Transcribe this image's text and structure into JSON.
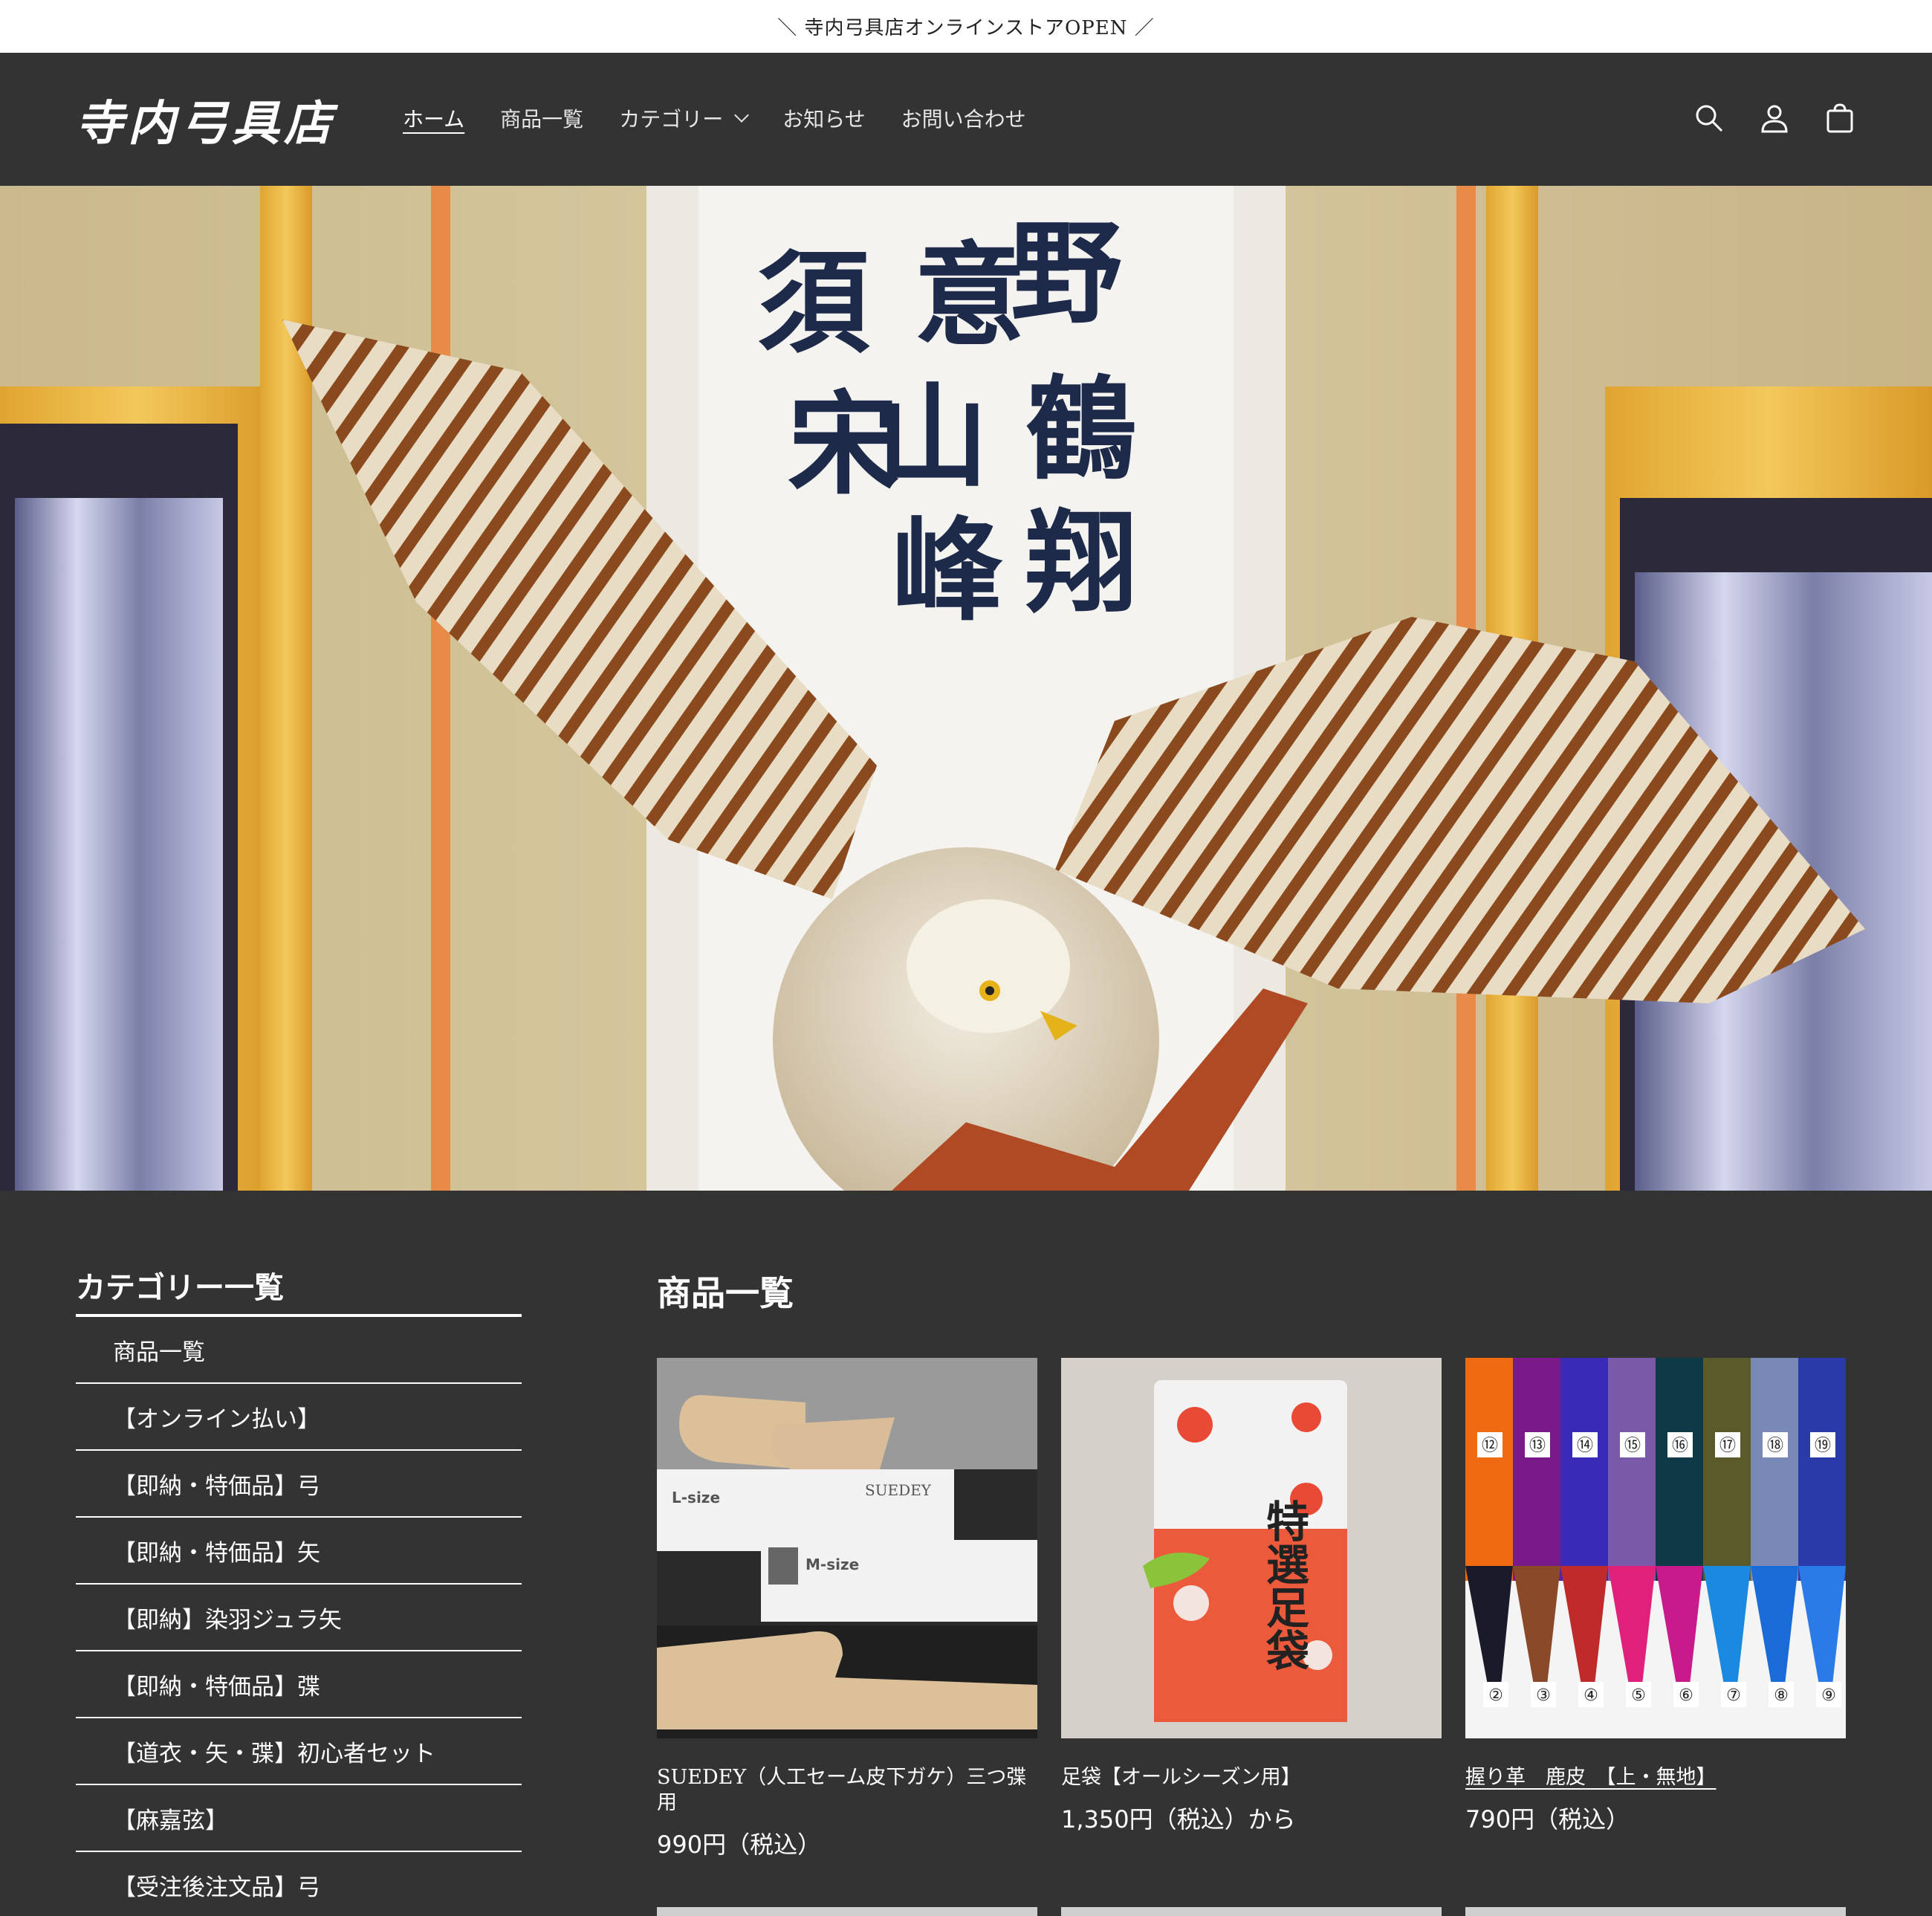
{
  "announcement": "＼ 寺内弓具店オンラインストアOPEN ／",
  "header": {
    "logo": "寺内弓具店",
    "nav": [
      {
        "label": "ホーム",
        "active": true
      },
      {
        "label": "商品一覧"
      },
      {
        "label": "カテゴリー",
        "dropdown": true
      },
      {
        "label": "お知らせ"
      },
      {
        "label": "お問い合わせ"
      }
    ],
    "icons": [
      "search-icon",
      "account-icon",
      "cart-icon"
    ]
  },
  "hero": {
    "calligraphy": [
      "野",
      "意",
      "須",
      "鶴",
      "山",
      "宋",
      "翔",
      "峰"
    ]
  },
  "sidebar": {
    "title": "カテゴリー一覧",
    "items": [
      "商品一覧",
      "【オンライン払い】",
      "【即納・特価品】弓",
      "【即納・特価品】矢",
      "【即納】染羽ジュラ矢",
      "【即納・特価品】弽",
      "【道衣・矢・弽】初心者セット",
      "【麻嘉弦】",
      "【受注後注文品】弓"
    ]
  },
  "main": {
    "title": "商品一覧",
    "products": [
      {
        "name": "SUEDEY（人工セーム皮下ガケ）三つ弽用",
        "price": "990円（税込）"
      },
      {
        "name": "足袋【オールシーズン用】",
        "price": "1,350円（税込）から"
      },
      {
        "name": "握り革　鹿皮　【上・無地】",
        "price": "790円（税込）"
      }
    ],
    "product1_labels": {
      "l_size": "L-size",
      "m_size": "M-size",
      "brand": "SUEDEY"
    },
    "product2_labels": {
      "pack_text": "特選足袋"
    },
    "product3_labels": {
      "top": [
        "⑫",
        "⑬",
        "⑭",
        "⑮",
        "⑯",
        "⑰",
        "⑱",
        "⑲"
      ],
      "bottom": [
        "②",
        "③",
        "④",
        "⑤",
        "⑥",
        "⑦",
        "⑧",
        "⑨"
      ]
    }
  },
  "colors": {
    "background": "#333333",
    "announcement_bg": "#ffffff",
    "text": "#ffffff"
  }
}
